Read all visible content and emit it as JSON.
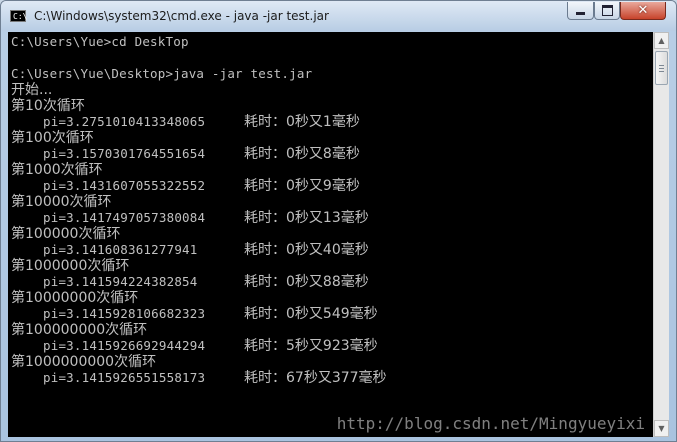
{
  "window": {
    "title": "C:\\Windows\\system32\\cmd.exe - java  -jar test.jar",
    "icon_text": "C:\\",
    "min_icon": "minimize-icon",
    "max_icon": "maximize-icon",
    "close_icon": "close-icon",
    "close_glyph": "✕"
  },
  "console": {
    "prompt1": "C:\\Users\\Yue>cd DeskTop",
    "prompt2": "C:\\Users\\Yue\\Desktop>java -jar test.jar",
    "start": "开始...",
    "runs": [
      {
        "label": "第10次循环",
        "pi": "pi=3.2751010413348065",
        "time": "耗时：0秒又1毫秒"
      },
      {
        "label": "第100次循环",
        "pi": "pi=3.1570301764551654",
        "time": "耗时：0秒又8毫秒"
      },
      {
        "label": "第1000次循环",
        "pi": "pi=3.1431607055322552",
        "time": "耗时：0秒又9毫秒"
      },
      {
        "label": "第10000次循环",
        "pi": "pi=3.1417497057380084",
        "time": "耗时：0秒又13毫秒"
      },
      {
        "label": "第100000次循环",
        "pi": "pi=3.141608361277941",
        "time": "耗时：0秒又40毫秒"
      },
      {
        "label": "第1000000次循环",
        "pi": "pi=3.141594224382854",
        "time": "耗时：0秒又88毫秒"
      },
      {
        "label": "第10000000次循环",
        "pi": "pi=3.1415928106682323",
        "time": "耗时：0秒又549毫秒"
      },
      {
        "label": "第100000000次循环",
        "pi": "pi=3.1415926692944294",
        "time": "耗时：5秒又923毫秒"
      },
      {
        "label": "第1000000000次循环",
        "pi": "pi=3.1415926551558173",
        "time": "耗时：67秒又377毫秒"
      }
    ]
  },
  "watermark": "http://blog.csdn.net/Mingyueyixi"
}
